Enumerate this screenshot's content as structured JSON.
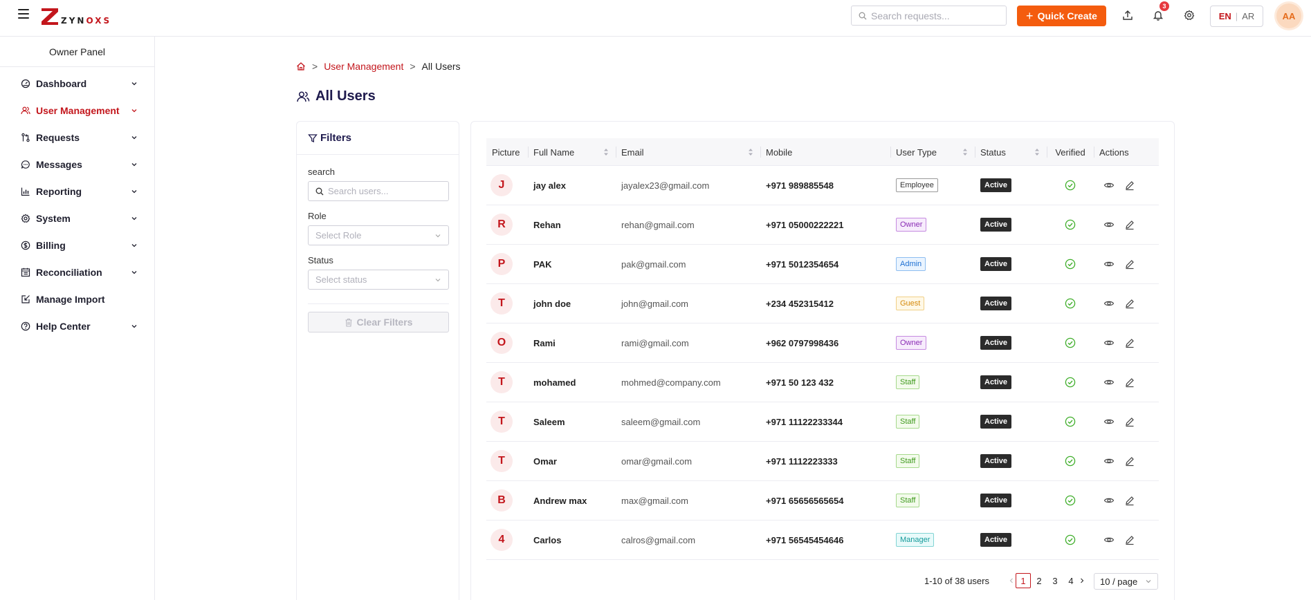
{
  "app": {
    "logo_text_dark": "ZYN",
    "logo_text_red": "OXS",
    "search_placeholder": "Search requests...",
    "quick_create_label": "Quick Create",
    "notification_count": "3",
    "lang_en": "EN",
    "lang_sep": "|",
    "lang_ar": "AR",
    "user_initials": "AA",
    "brand_color": "#c3161c",
    "accent_color": "#f45c0e"
  },
  "sidebar": {
    "panel_title": "Owner Panel",
    "items": [
      {
        "label": "Dashboard",
        "icon": "dashboard-icon",
        "has_chevron": true
      },
      {
        "label": "User Management",
        "icon": "users-icon",
        "has_chevron": true,
        "active": true
      },
      {
        "label": "Requests",
        "icon": "requests-icon",
        "has_chevron": true
      },
      {
        "label": "Messages",
        "icon": "message-icon",
        "has_chevron": true
      },
      {
        "label": "Reporting",
        "icon": "bar-chart-icon",
        "has_chevron": true
      },
      {
        "label": "System",
        "icon": "gear-icon",
        "has_chevron": true
      },
      {
        "label": "Billing",
        "icon": "dollar-icon",
        "has_chevron": true
      },
      {
        "label": "Reconciliation",
        "icon": "ledger-icon",
        "has_chevron": true
      },
      {
        "label": "Manage Import",
        "icon": "import-icon",
        "has_chevron": false
      },
      {
        "label": "Help Center",
        "icon": "help-icon",
        "has_chevron": true
      }
    ]
  },
  "breadcrumb": {
    "sep": ">",
    "section": "User Management",
    "current": "All Users"
  },
  "page": {
    "title": "All Users"
  },
  "filters": {
    "title": "Filters",
    "search_label": "search",
    "search_placeholder": "Search users...",
    "role_label": "Role",
    "role_placeholder": "Select Role",
    "status_label": "Status",
    "status_placeholder": "Select status",
    "clear_label": "Clear Filters"
  },
  "table": {
    "columns": [
      "Picture",
      "Full Name",
      "Email",
      "Mobile",
      "User Type",
      "Status",
      "Verified",
      "Actions"
    ],
    "rows": [
      {
        "initial": "J",
        "name": "jay alex",
        "email": "jayalex23@gmail.com",
        "mobile": "+971 989885548",
        "type": "Employee",
        "status": "Active"
      },
      {
        "initial": "R",
        "name": "Rehan",
        "email": "rehan@gmail.com",
        "mobile": "+971 05000222221",
        "type": "Owner",
        "status": "Active"
      },
      {
        "initial": "P",
        "name": "PAK",
        "email": "pak@gmail.com",
        "mobile": "+971 5012354654",
        "type": "Admin",
        "status": "Active"
      },
      {
        "initial": "T",
        "name": "john doe",
        "email": "john@gmail.com",
        "mobile": "+234 452315412",
        "type": "Guest",
        "status": "Active"
      },
      {
        "initial": "O",
        "name": "Rami",
        "email": "rami@gmail.com",
        "mobile": "+962 0797998436",
        "type": "Owner",
        "status": "Active"
      },
      {
        "initial": "T",
        "name": "mohamed",
        "email": "mohmed@company.com",
        "mobile": "+971 50 123 432",
        "type": "Staff",
        "status": "Active"
      },
      {
        "initial": "T",
        "name": "Saleem",
        "email": "saleem@gmail.com",
        "mobile": "+971 11122233344",
        "type": "Staff",
        "status": "Active"
      },
      {
        "initial": "T",
        "name": "Omar",
        "email": "omar@gmail.com",
        "mobile": "+971 1112223333",
        "type": "Staff",
        "status": "Active"
      },
      {
        "initial": "B",
        "name": "Andrew max",
        "email": "max@gmail.com",
        "mobile": "+971 65656565654",
        "type": "Staff",
        "status": "Active"
      },
      {
        "initial": "4",
        "name": "Carlos",
        "email": "calros@gmail.com",
        "mobile": "+971 56545454646",
        "type": "Manager",
        "status": "Active"
      }
    ],
    "type_colors": {
      "Employee": {
        "fg": "#333333",
        "bg": "#ffffff",
        "border": "#999999"
      },
      "Owner": {
        "fg": "#8a2bb5",
        "bg": "#f7ecfc",
        "border": "#c58ae0"
      },
      "Admin": {
        "fg": "#1d6fd1",
        "bg": "#eaf4ff",
        "border": "#8dbdf0"
      },
      "Guest": {
        "fg": "#d4890b",
        "bg": "#fff8e6",
        "border": "#f0cf86"
      },
      "Staff": {
        "fg": "#3f9a1d",
        "bg": "#f3fbec",
        "border": "#a6d98c"
      },
      "Manager": {
        "fg": "#139a9a",
        "bg": "#e8fafa",
        "border": "#82d4d4"
      }
    },
    "verified_color": "#3fae2a"
  },
  "pagination": {
    "summary": "1-10 of 38 users",
    "pages": [
      "1",
      "2",
      "3",
      "4"
    ],
    "current": "1",
    "page_size": "10 / page"
  }
}
